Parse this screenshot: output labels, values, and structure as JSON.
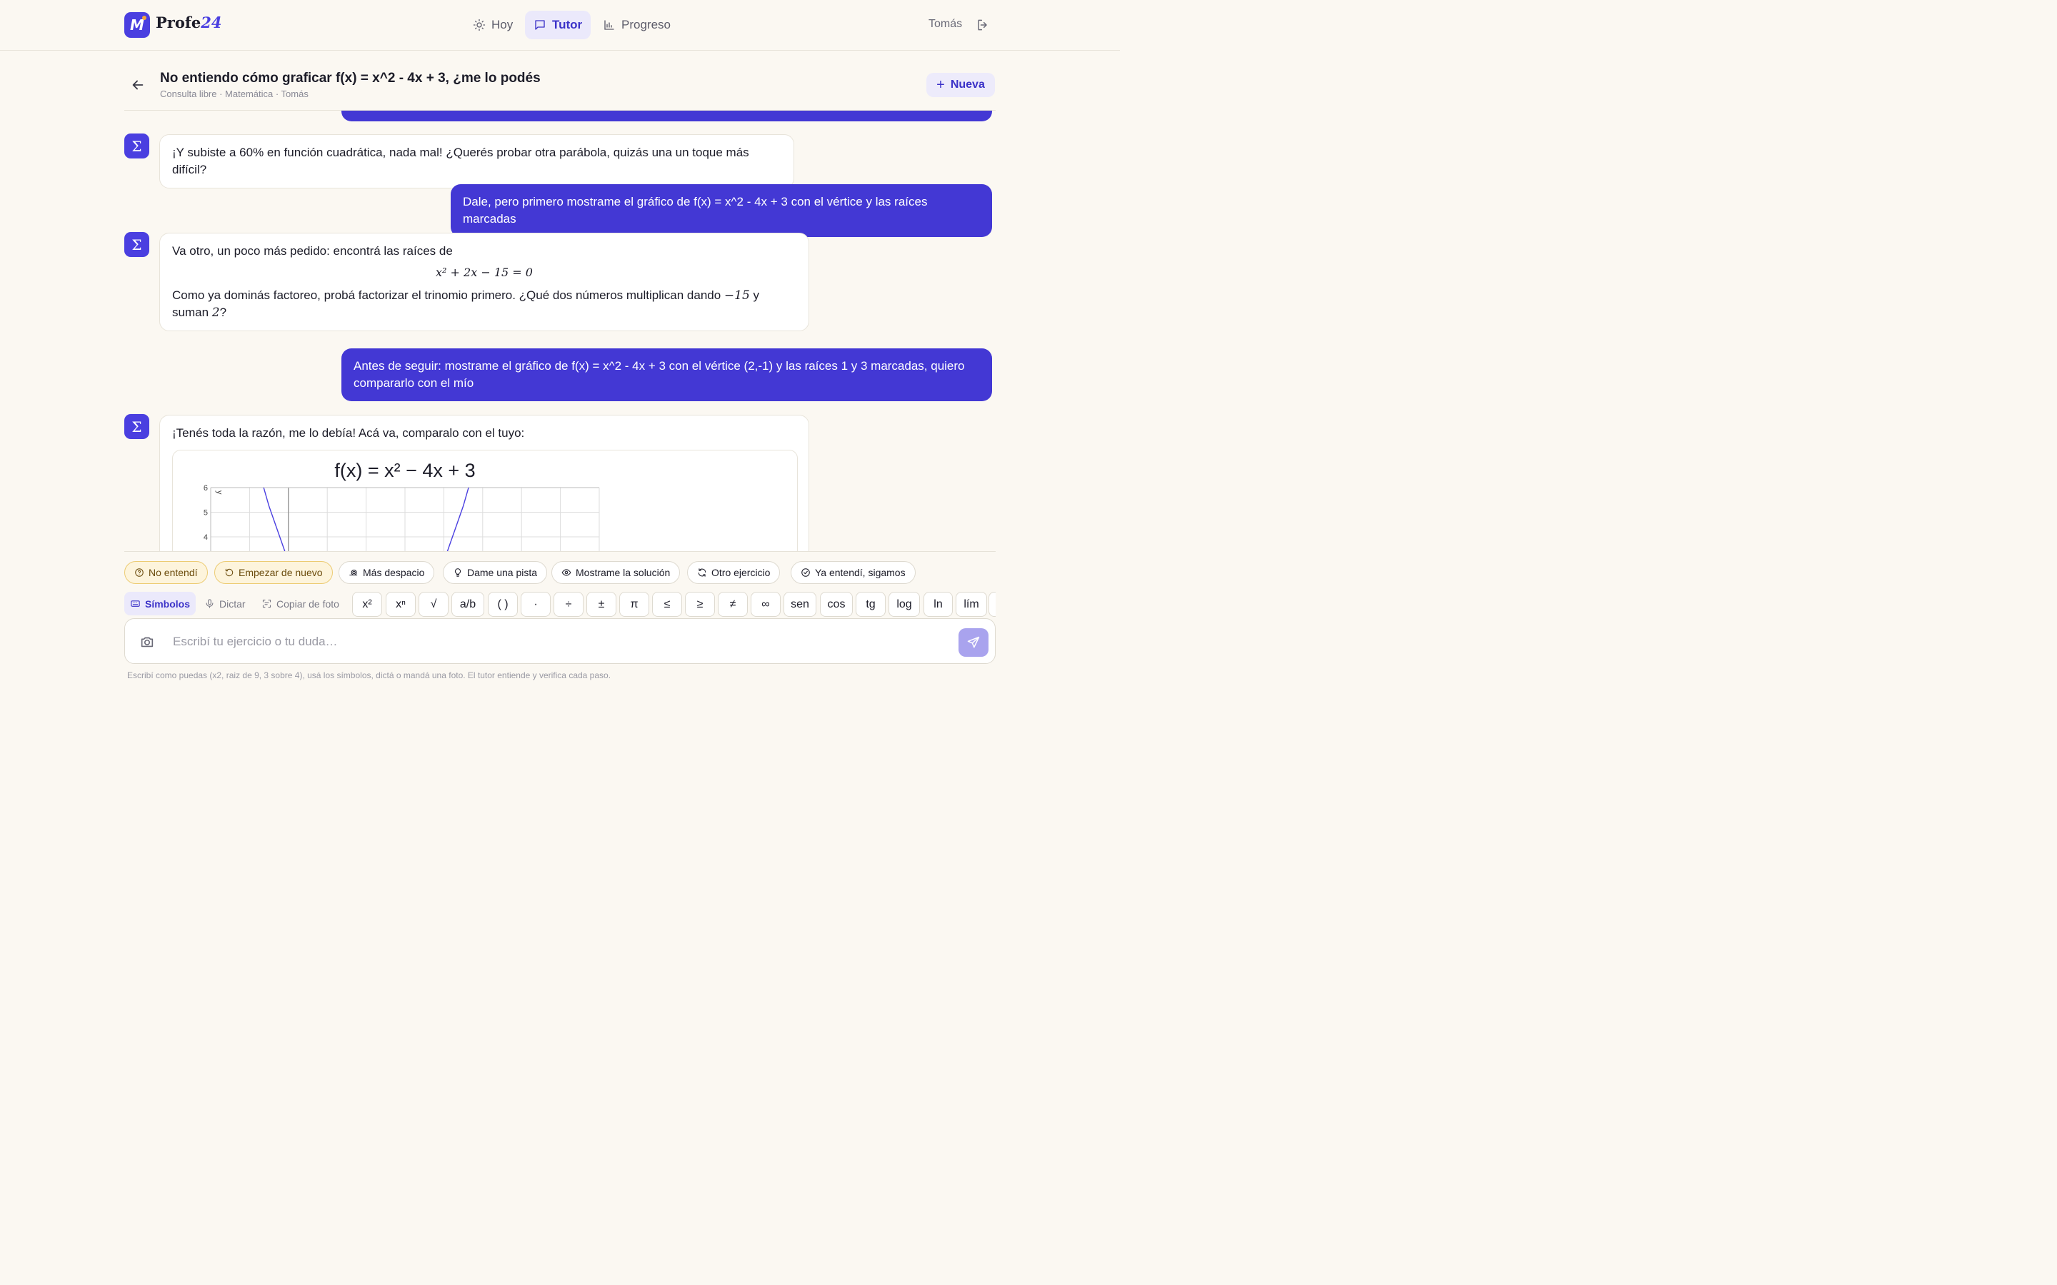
{
  "brand": {
    "name": "Profe",
    "number": "24"
  },
  "nav": [
    {
      "label": "Hoy",
      "icon": "sun-icon",
      "active": false
    },
    {
      "label": "Tutor",
      "icon": "chat-icon",
      "active": true
    },
    {
      "label": "Progreso",
      "icon": "bar-chart-icon",
      "active": false
    }
  ],
  "user": {
    "name": "Tomás"
  },
  "conversation": {
    "title": "No entiendo cómo graficar f(x) = x^2 - 4x + 3, ¿me lo podés",
    "subtitle": "Consulta libre · Matemática · Tomás",
    "new_label": "Nueva"
  },
  "messages": {
    "bot1": "¡Y subiste a 60% en función cuadrática, nada mal! ¿Querés probar otra parábola, quizás una un toque más difícil?",
    "user1": "Dale, pero primero mostrame el gráfico de f(x) = x^2 - 4x + 3 con el vértice y las raíces marcadas",
    "bot2_intro": "Va otro, un poco más pedido: encontrá las raíces de",
    "bot2_equation": "x² + 2x − 15 = 0",
    "bot2_text_a": "Como ya dominás factoreo, probá factorizar el trinomio primero. ¿Qué dos números multiplican dando ",
    "bot2_num1": "−15",
    "bot2_text_b": " y suman ",
    "bot2_num2": "2",
    "bot2_text_c": "?",
    "user2": "Antes de seguir: mostrame el gráfico de f(x) = x^2 - 4x + 3 con el vértice (2,-1) y las raíces 1 y 3 marcadas, quiero compararlo con el mío",
    "bot3": "¡Tenés toda la razón, me lo debía! Acá va, comparalo con el tuyo:"
  },
  "chart_data": {
    "type": "line",
    "title": "f(x) = x² − 4x + 3",
    "ylabel": "y",
    "xlim": [
      -2,
      8
    ],
    "ylim": [
      0,
      6
    ],
    "yticks": [
      4,
      5,
      6
    ],
    "grid": true,
    "series": [
      {
        "name": "",
        "x": [
          -1,
          -0.5,
          0,
          0.5,
          1,
          1.5,
          2,
          2.5,
          3,
          3.5,
          4,
          4.5,
          5,
          5.5
        ],
        "values": [
          8,
          5.25,
          3,
          1.25,
          0,
          -0.75,
          -1,
          -0.75,
          0,
          1.25,
          3,
          5.25,
          8,
          11.25
        ]
      }
    ],
    "line_color": "#4a3fe0"
  },
  "chips": [
    {
      "label": "No entendí",
      "icon": "help-circle-icon",
      "warn": true
    },
    {
      "label": "Empezar de nuevo",
      "icon": "restart-icon",
      "warn": true
    },
    {
      "label": "Más despacio",
      "icon": "snail-icon",
      "warn": false
    },
    {
      "label": "Dame una pista",
      "icon": "lightbulb-icon",
      "warn": false
    },
    {
      "label": "Mostrame la solución",
      "icon": "eye-icon",
      "warn": false
    },
    {
      "label": "Otro ejercicio",
      "icon": "refresh-icon",
      "warn": false
    },
    {
      "label": "Ya entendí, sigamos",
      "icon": "check-circle-icon",
      "warn": false
    }
  ],
  "tools": [
    {
      "label": "Símbolos",
      "icon": "keyboard-icon",
      "active": true
    },
    {
      "label": "Dictar",
      "icon": "mic-icon",
      "active": false
    },
    {
      "label": "Copiar de foto",
      "icon": "scan-icon",
      "active": false
    }
  ],
  "keys": [
    "x²",
    "xⁿ",
    "√",
    "a/b",
    "( )",
    "·",
    "÷",
    "±",
    "π",
    "≤",
    "≥",
    "≠",
    "∞",
    "sen",
    "cos",
    "tg",
    "log",
    "ln",
    "lím"
  ],
  "input": {
    "placeholder": "Escribí tu ejercicio o tu duda…",
    "value": ""
  },
  "hint": "Escribí como puedas (x2, raiz de 9, 3 sobre 4), usá los símbolos, dictá o mandá una foto. El tutor entiende y verifica cada paso.",
  "colors": {
    "accent": "#4338d4",
    "background": "#fbf8f2",
    "warn": "#fdf4dc"
  }
}
